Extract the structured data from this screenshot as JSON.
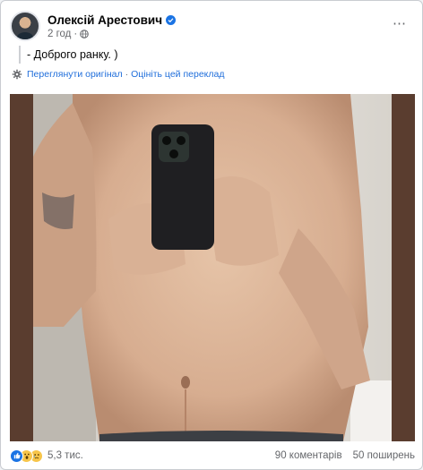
{
  "post": {
    "author": "Олексій Арестович",
    "time": "2 год",
    "text": "- Доброго ранку. )",
    "see_original": "Переглянути оригінал",
    "separator": "·",
    "rate_translation": "Оцініть цей переклад"
  },
  "footer": {
    "reactions": [
      "like-icon",
      "wow-icon",
      "sad-icon"
    ],
    "reaction_count": "5,3 тис.",
    "comments": "90 коментарів",
    "shares": "50 поширень"
  },
  "colors": {
    "link": "#216fdb",
    "muted": "#65676b",
    "verified": "#1b74e4",
    "photo_frame": "#5a3d2f"
  }
}
